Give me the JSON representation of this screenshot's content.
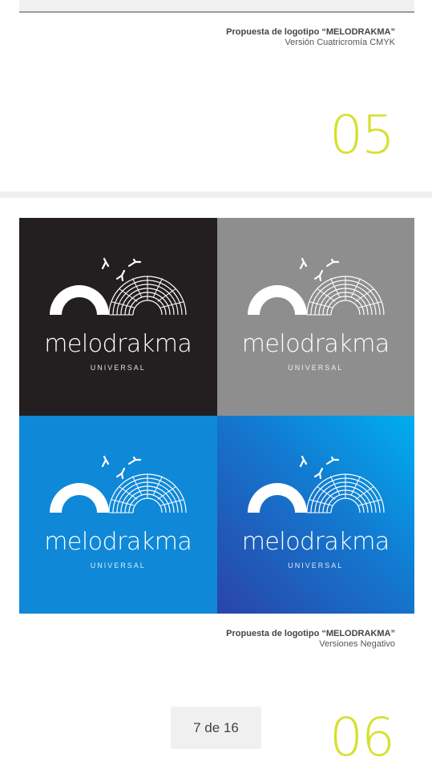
{
  "section_05": {
    "caption_title": "Propuesta de logotipo “MELODRAKMA”",
    "caption_subtitle": "Versión Cuatricromía CMYK",
    "page_number": "05"
  },
  "logo_tiles": [
    {
      "wordmark": "melodrakma",
      "tagline": "UNIVERSAL",
      "background": "#231f20"
    },
    {
      "wordmark": "melodrakma",
      "tagline": "UNIVERSAL",
      "background": "#8e8e8e"
    },
    {
      "wordmark": "melodrakma",
      "tagline": "UNIVERSAL",
      "background": "#0f88d8"
    },
    {
      "wordmark": "melodrakma",
      "tagline": "UNIVERSAL",
      "background_gradient": [
        "#00aeef",
        "#2a44a8"
      ]
    }
  ],
  "section_06": {
    "caption_title": "Propuesta de logotipo “MELODRAKMA”",
    "caption_subtitle": "Versiones Negativo",
    "page_number": "06"
  },
  "pager": {
    "label": "7 de 16"
  },
  "colors": {
    "accent_number": "#d6e02e"
  }
}
